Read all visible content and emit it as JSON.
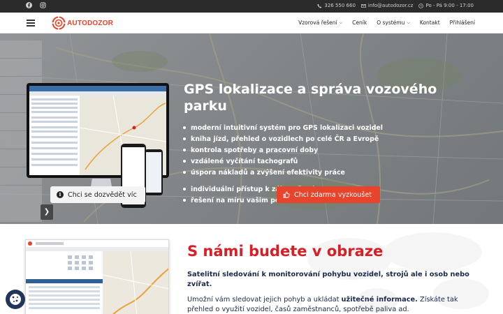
{
  "topbar": {
    "social": [
      "facebook-icon",
      "instagram-icon"
    ],
    "phone": "326 550 660",
    "email": "info@autodozor.cz",
    "hours": "Po - Pá 9:00 - 17:00"
  },
  "nav": {
    "logo_prefix": "AUTO",
    "logo_suffix": "DOZOR",
    "items": [
      {
        "label": "Vzorová řešení",
        "dropdown": true
      },
      {
        "label": "Ceník",
        "dropdown": false
      },
      {
        "label": "O systému",
        "dropdown": true
      },
      {
        "label": "Kontakt",
        "dropdown": false
      },
      {
        "label": "Přihlášení",
        "dropdown": false
      }
    ]
  },
  "hero": {
    "title": "GPS lokalizace a správa vozového parku",
    "features": [
      "moderní intuitivní systém pro GPS lokalizaci vozidel",
      "kniha jízd, přehled o vozidlech po celé ČR a Evropě",
      "kontrola spotřeby a pracovní doby",
      "vzdálené vyčítání tachografů",
      "úspora nákladů a zvýšení efektivity práce"
    ],
    "features2": [
      "individuální přístup k zákazníkovi",
      "řešení na míru vašim potřebám"
    ],
    "btn_info": "Chci se dozvědět víc",
    "btn_try": "Chci zdarma vyzkoušet"
  },
  "section2": {
    "heading": "S námi budete v obraze",
    "lead": "Satelitní sledování k monitorování pohybu vozidel, strojů ale i osob nebo zvířat.",
    "body_start": "Umožní vám sledovat jejich pohyb a ukládat ",
    "body_bold": "užitečné informace.",
    "body_end": " Získáte tak přehled o využití vozidel, časů zaměstnanců, spotřebě paliva ad."
  },
  "colors": {
    "brand": "#e8432b",
    "heading_red": "#d81f26",
    "topbar": "#2b2b2b",
    "text_dark": "#1b2a4a"
  }
}
